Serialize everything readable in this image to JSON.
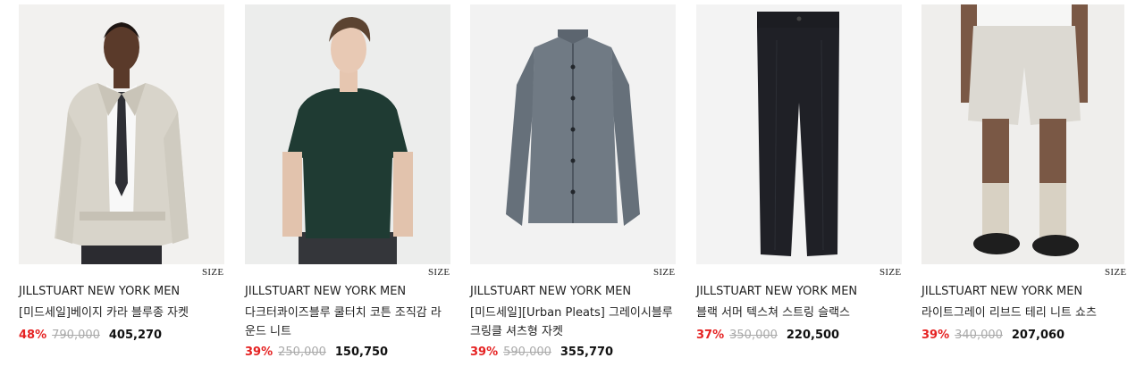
{
  "size_label": "SIZE",
  "products": [
    {
      "brand": "JILLSTUART NEW YORK MEN",
      "name": "[미드세일]베이지 카라 블루종 자켓",
      "discount": "48%",
      "original_price": "790,000",
      "sale_price": "405,270",
      "image": "model-beige-blouson-jacket"
    },
    {
      "brand": "JILLSTUART NEW YORK MEN",
      "name": "다크터콰이즈블루 쿨터치 코튼 조직감 라운드 니트",
      "discount": "39%",
      "original_price": "250,000",
      "sale_price": "150,750",
      "image": "model-green-knit-tee"
    },
    {
      "brand": "JILLSTUART NEW YORK MEN",
      "name": "[미드세일][Urban Pleats] 그레이시블루 크링클 셔츠형 자켓",
      "discount": "39%",
      "original_price": "590,000",
      "sale_price": "355,770",
      "image": "flat-grey-shirt-jacket"
    },
    {
      "brand": "JILLSTUART NEW YORK MEN",
      "name": "블랙 서머 텍스쳐 스트링 슬랙스",
      "discount": "37%",
      "original_price": "350,000",
      "sale_price": "220,500",
      "image": "flat-black-slacks"
    },
    {
      "brand": "JILLSTUART NEW YORK MEN",
      "name": "라이트그레이 리브드 테리 니트 쇼츠",
      "discount": "39%",
      "original_price": "340,000",
      "sale_price": "207,060",
      "image": "model-grey-knit-shorts"
    }
  ]
}
